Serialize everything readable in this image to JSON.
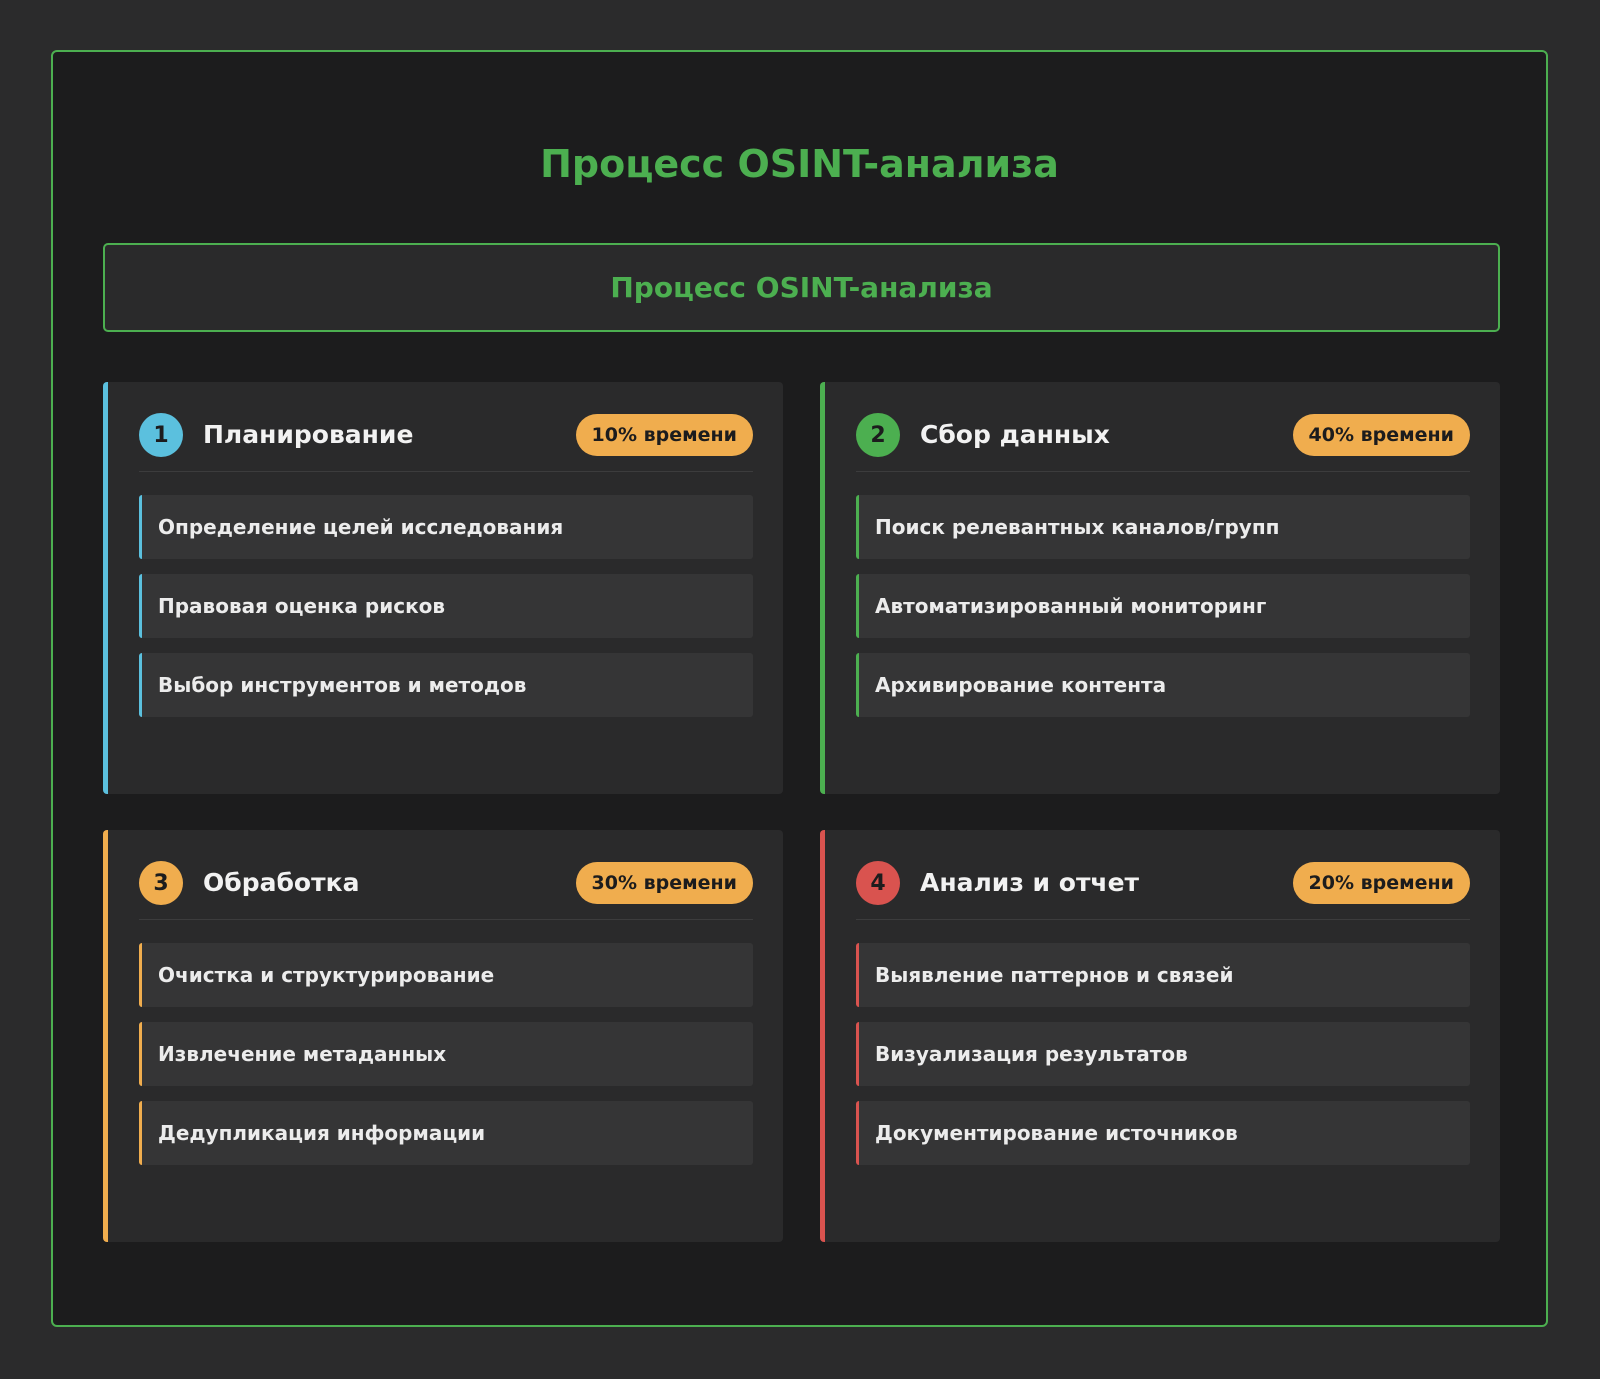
{
  "title": "Процесс OSINT-анализа",
  "banner": {
    "title": "Процесс OSINT-анализа"
  },
  "colors": {
    "accent": "#4caf50",
    "stage1": "#5bc0de",
    "stage2": "#4caf50",
    "stage3": "#f0ad4e",
    "stage4": "#d9534f",
    "badge": "#f0ad4e"
  },
  "stages": [
    {
      "number": "1",
      "title": "Планирование",
      "badge": "10% времени",
      "items": [
        "Определение целей исследования",
        "Правовая оценка рисков",
        "Выбор инструментов и методов"
      ]
    },
    {
      "number": "2",
      "title": "Сбор данных",
      "badge": "40% времени",
      "items": [
        "Поиск релевантных каналов/групп",
        "Автоматизированный мониторинг",
        "Архивирование контента"
      ]
    },
    {
      "number": "3",
      "title": "Обработка",
      "badge": "30% времени",
      "items": [
        "Очистка и структурирование",
        "Извлечение метаданных",
        "Дедупликация информации"
      ]
    },
    {
      "number": "4",
      "title": "Анализ и отчет",
      "badge": "20% времени",
      "items": [
        "Выявление паттернов и связей",
        "Визуализация результатов",
        "Документирование источников"
      ]
    }
  ]
}
